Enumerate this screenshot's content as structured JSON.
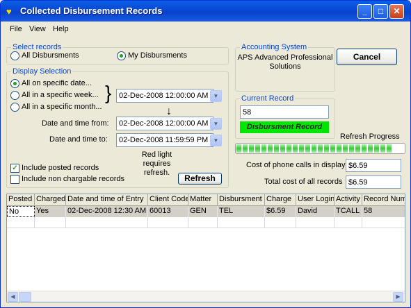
{
  "window": {
    "title": "Collected Disbursement Records",
    "min": "_",
    "max": "□",
    "close": "✕"
  },
  "menu": [
    {
      "label": "File"
    },
    {
      "label": "View"
    },
    {
      "label": "Help"
    }
  ],
  "select_records": {
    "title": "Select records",
    "options": [
      {
        "label": "All Disbursments",
        "selected": false
      },
      {
        "label": "My Disbursments",
        "selected": true
      }
    ]
  },
  "accounting": {
    "title": "Accounting System",
    "value": "APS Advanced Professional Solutions"
  },
  "cancel_label": "Cancel",
  "display_selection": {
    "title": "Display Selection",
    "options": [
      {
        "label": "All on specific date...",
        "selected": true
      },
      {
        "label": "All in a specific week...",
        "selected": false
      },
      {
        "label": "All in a specific month...",
        "selected": false
      }
    ],
    "date_value": "02-Dec-2008 12:00:00 AM",
    "from_label": "Date and time from:",
    "from_value": "02-Dec-2008 12:00:00 AM",
    "to_label": "Date and time to:",
    "to_value": "02-Dec-2008 11:59:59 PM",
    "include_posted": "Include posted records",
    "include_posted_checked": true,
    "include_non_chargable": "Include non chargable records",
    "include_non_chargable_checked": false,
    "red_light_text": "Red light requires refresh.",
    "refresh_label": "Refresh"
  },
  "current_record": {
    "title": "Current Record",
    "value": "58",
    "status": "Disbursment Record",
    "status_color": "#00e600"
  },
  "refresh_progress_label": "Refresh Progress",
  "cost_phone_label": "Cost of phone calls in display",
  "cost_phone_value": "$6.59",
  "total_cost_label": "Total cost of all records",
  "total_cost_value": "$6.59",
  "table": {
    "headers": [
      "Posted",
      "Charged",
      "Date and time of Entry",
      "Client Code",
      "Matter",
      "Disbursment",
      "Charge",
      "User Login",
      "Activity",
      "Record Num"
    ],
    "rows": [
      [
        "No",
        "Yes",
        "02-Dec-2008 12:30 AM",
        "60013",
        "GEN",
        "TEL",
        "$6.59",
        "David",
        "TCALL",
        "58"
      ]
    ]
  }
}
